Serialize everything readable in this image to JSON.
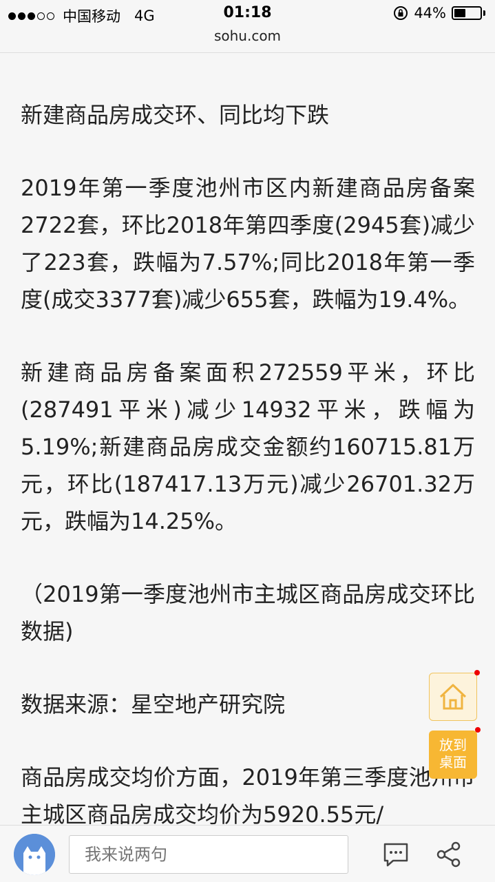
{
  "status": {
    "carrier": "中国移动",
    "network": "4G",
    "time": "01:18",
    "battery": "44%",
    "battery_level": 0.44
  },
  "browser": {
    "url": "sohu.com"
  },
  "article": {
    "heading": "新建商品房成交环、同比均下跌",
    "paragraphs": [
      "2019年第一季度池州市区内新建商品房备案2722套，环比2018年第四季度(2945套)减少了223套，跌幅为7.57%;同比2018年第一季度(成交3377套)减少655套，跌幅为19.4%。",
      "新建商品房备案面积272559平米，环比(287491平米)减少14932平米，跌幅为5.19%;新建商品房成交金额约160715.81万元，环比(187417.13万元)减少26701.32万元，跌幅为14.25%。",
      "（2019第一季度池州市主城区商品房成交环比数据)",
      "数据来源：星空地产研究院",
      "商品房成交均价方面，2019年第三季度池州市主城区商品房成交均价为5920.55元/"
    ]
  },
  "floating": {
    "home_icon": "home-icon",
    "desktop_label_line1": "放到",
    "desktop_label_line2": "桌面"
  },
  "comment_bar": {
    "placeholder": "我来说两句",
    "comment_icon": "comment-icon",
    "share_icon": "share-icon"
  },
  "colors": {
    "accent": "#f7b733",
    "avatar_bg": "#5b8fd9"
  }
}
